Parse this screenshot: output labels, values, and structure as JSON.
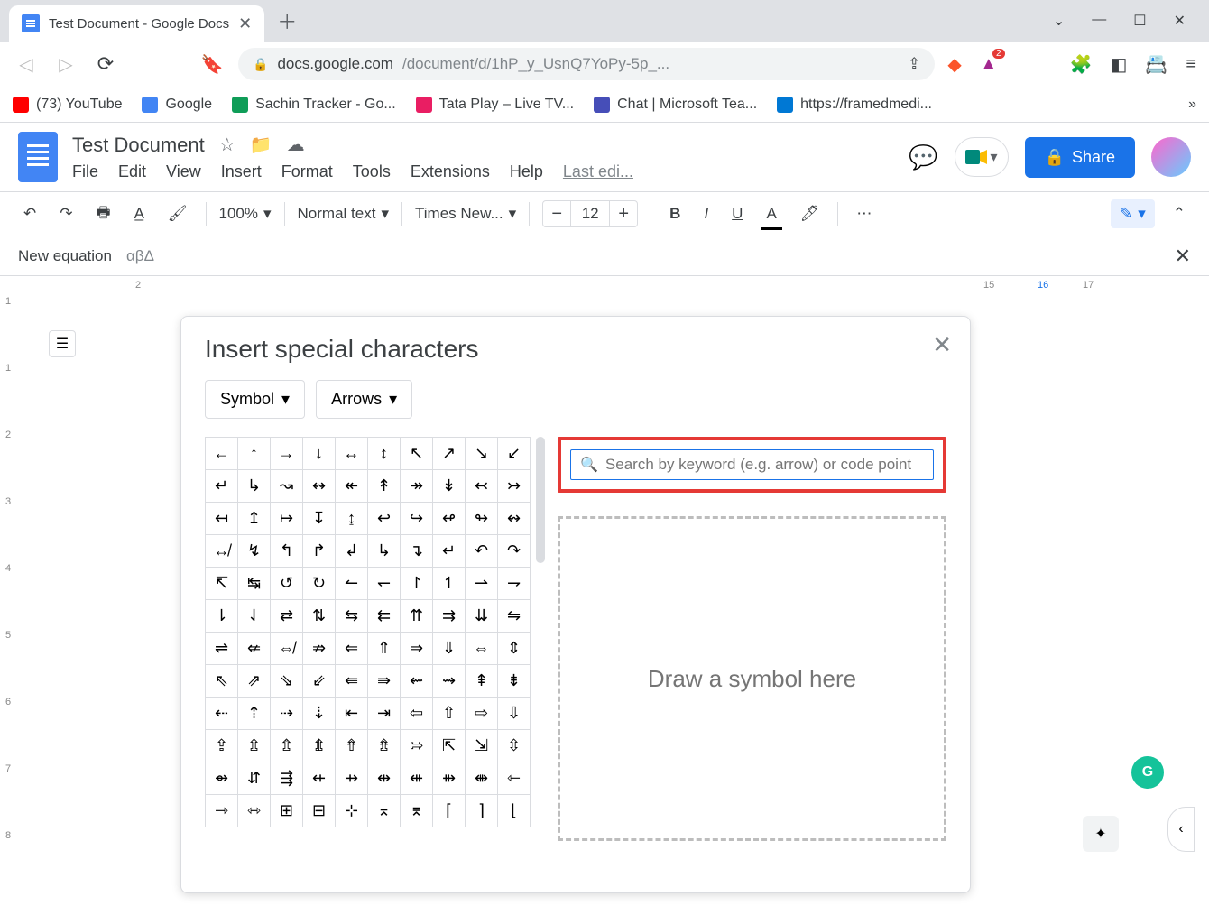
{
  "browser": {
    "tab_title": "Test Document - Google Docs",
    "url_display_host": "docs.google.com",
    "url_display_path": "/document/d/1hP_y_UsnQ7YoPy-5p_...",
    "bookmarks": [
      {
        "label": "(73) YouTube",
        "color": "#ff0000"
      },
      {
        "label": "Google",
        "color": "#4285f4"
      },
      {
        "label": "Sachin Tracker - Go...",
        "color": "#0f9d58"
      },
      {
        "label": "Tata Play – Live TV...",
        "color": "#e91e63"
      },
      {
        "label": "Chat | Microsoft Tea...",
        "color": "#464eb8"
      },
      {
        "label": "https://framedmedi...",
        "color": "#0078d4"
      }
    ]
  },
  "doc": {
    "title": "Test Document",
    "menus": [
      "File",
      "Edit",
      "View",
      "Insert",
      "Format",
      "Tools",
      "Extensions",
      "Help"
    ],
    "last_edit": "Last edi...",
    "share_label": "Share"
  },
  "toolbar": {
    "zoom": "100%",
    "style": "Normal text",
    "font": "Times New...",
    "font_size": "12"
  },
  "eq_bar": {
    "label": "New equation",
    "greek_preview": "αβΔ"
  },
  "dialog": {
    "title": "Insert special characters",
    "dd1": "Symbol",
    "dd2": "Arrows",
    "search_placeholder": "Search by keyword (e.g. arrow) or code point",
    "draw_label": "Draw a symbol here",
    "chars": [
      "←",
      "↑",
      "→",
      "↓",
      "↔",
      "↕",
      "↖",
      "↗",
      "↘",
      "↙",
      "↵",
      "↳",
      "↝",
      "↭",
      "↞",
      "↟",
      "↠",
      "↡",
      "↢",
      "↣",
      "↤",
      "↥",
      "↦",
      "↧",
      "↨",
      "↩",
      "↪",
      "↫",
      "↬",
      "↭",
      "↮",
      "↯",
      "↰",
      "↱",
      "↲",
      "↳",
      "↴",
      "↵",
      "↶",
      "↷",
      "↸",
      "↹",
      "↺",
      "↻",
      "↼",
      "↽",
      "↾",
      "↿",
      "⇀",
      "⇁",
      "⇂",
      "⇃",
      "⇄",
      "⇅",
      "⇆",
      "⇇",
      "⇈",
      "⇉",
      "⇊",
      "⇋",
      "⇌",
      "⇍",
      "⇎",
      "⇏",
      "⇐",
      "⇑",
      "⇒",
      "⇓",
      "⇔",
      "⇕",
      "⇖",
      "⇗",
      "⇘",
      "⇙",
      "⇚",
      "⇛",
      "⇜",
      "⇝",
      "⇞",
      "⇟",
      "⇠",
      "⇡",
      "⇢",
      "⇣",
      "⇤",
      "⇥",
      "⇦",
      "⇧",
      "⇨",
      "⇩",
      "⇪",
      "⇫",
      "⇬",
      "⇭",
      "⇮",
      "⇯",
      "⇰",
      "⇱",
      "⇲",
      "⇳",
      "⇴",
      "⇵",
      "⇶",
      "⇷",
      "⇸",
      "⇹",
      "⇺",
      "⇻",
      "⇼",
      "⇽",
      "⇾",
      "⇿",
      "⊞",
      "⊟",
      "⊹",
      "⌅",
      "⌆",
      "⌈",
      "⌉",
      "⌊"
    ]
  },
  "ruler_h": [
    "2",
    "15",
    "16",
    "17"
  ],
  "ruler_v": [
    "1",
    "1",
    "2",
    "3",
    "4",
    "5",
    "6",
    "7",
    "8"
  ]
}
